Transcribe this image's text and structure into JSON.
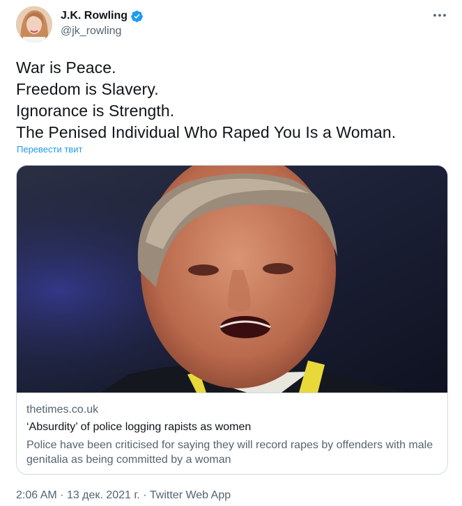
{
  "author": {
    "display_name": "J.K. Rowling",
    "handle": "@jk_rowling",
    "verified": true
  },
  "tweet": {
    "lines": [
      "War is Peace.",
      "Freedom is Slavery.",
      "Ignorance is Strength.",
      "The Penised Individual Who Raped You Is a Woman."
    ],
    "translate_label": "Перевести твит"
  },
  "card": {
    "domain": "thetimes.co.uk",
    "title": "‘Absurdity’ of police logging rapists as women",
    "description": "Police have been criticised for saying they will record rapes by offenders with male genitalia as being committed by a woman"
  },
  "meta": {
    "time": "2:06 AM",
    "separator": "·",
    "date": "13 дек. 2021 г.",
    "source": "Twitter Web App"
  },
  "icons": {
    "verified": "verified-badge-icon",
    "more": "more-options-icon"
  },
  "colors": {
    "accent": "#1d9bf0",
    "text_primary": "#0f1419",
    "text_secondary": "#536471",
    "border": "#cfd9de"
  }
}
